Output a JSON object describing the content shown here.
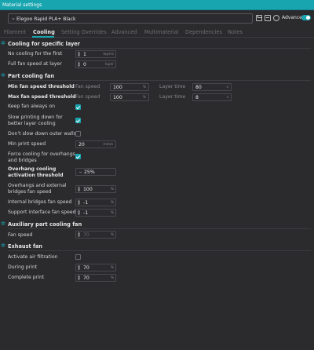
{
  "window": {
    "title": "Material settings"
  },
  "toolbar": {
    "preset": "Elegoo Rapid PLA+ Black",
    "advanced_label": "Advanced"
  },
  "tabs": [
    "Filament",
    "Cooling",
    "Setting Overrides",
    "Advanced",
    "Multimaterial",
    "Dependencies",
    "Notes"
  ],
  "active_tab": "Cooling",
  "accent_color": "#19a5b0",
  "cooling_layer": {
    "title": "Cooling for specific layer",
    "no_cooling_label": "No cooling for the first",
    "no_cooling_value": "1",
    "no_cooling_unit": "layers",
    "full_fan_label": "Full fan speed at layer",
    "full_fan_value": "0",
    "full_fan_unit": "layer"
  },
  "part_cooling": {
    "title": "Part cooling fan",
    "min_label": "Min fan speed threshold",
    "max_label": "Max fan speed threshold",
    "fan_speed_sub": "Fan speed",
    "layer_time_sub": "Layer time",
    "min_fan_speed": "100",
    "min_layer_time": "80",
    "max_fan_speed": "100",
    "max_layer_time": "8",
    "percent_unit": "%",
    "seconds_unit": "s",
    "keep_fan_label": "Keep fan always on",
    "slow_down_label": "Slow printing down for better layer cooling",
    "dont_slow_label": "Don't slow down outer walls",
    "min_print_speed_label": "Min print speed",
    "min_print_speed_value": "20",
    "min_print_speed_unit": "mm/s",
    "force_cooling_label": "Force cooling for overhangs and bridges",
    "overhang_threshold_label": "Overhang cooling activation threshold",
    "overhang_threshold_value": "25%",
    "overhang_fan_label": "Overhangs and external bridges fan speed",
    "overhang_fan_value": "100",
    "internal_bridge_label": "Internal bridges fan speed",
    "internal_bridge_value": "-1",
    "support_iface_label": "Support interface fan speed",
    "support_iface_value": "-1"
  },
  "aux_fan": {
    "title": "Auxiliary part cooling fan",
    "fan_speed_label": "Fan speed",
    "fan_speed_value": "70"
  },
  "exhaust": {
    "title": "Exhaust fan",
    "activate_label": "Activate air filtration",
    "during_label": "During print",
    "during_value": "70",
    "complete_label": "Complete print",
    "complete_value": "70"
  }
}
